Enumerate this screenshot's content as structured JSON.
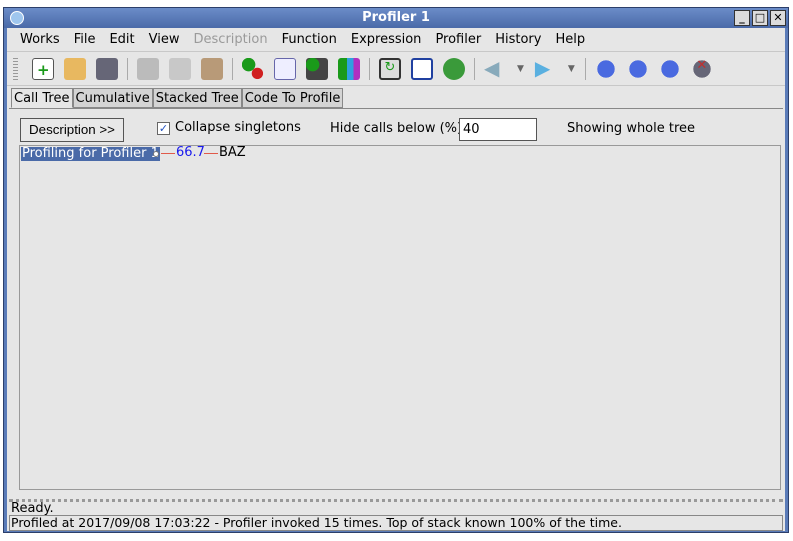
{
  "window": {
    "title": "Profiler 1"
  },
  "menu": [
    "Works",
    "File",
    "Edit",
    "View",
    "Description",
    "Function",
    "Expression",
    "Profiler",
    "History",
    "Help"
  ],
  "tabs": [
    "Call Tree",
    "Cumulative",
    "Stacked Tree",
    "Code To Profile"
  ],
  "controls": {
    "description_button": "Description >>",
    "collapse_label": "Collapse singletons",
    "collapse_checked": true,
    "hide_label": "Hide calls below (%)",
    "hide_value": "40",
    "showing": "Showing whole tree"
  },
  "tree": {
    "root": "Profiling for Profiler 1",
    "percent": "66.7",
    "child": "BAZ"
  },
  "status": {
    "line1": "Ready.",
    "line2": "Profiled at 2017/09/08 17:03:22 - Profiler invoked 15 times. Top of stack known 100% of the time."
  }
}
